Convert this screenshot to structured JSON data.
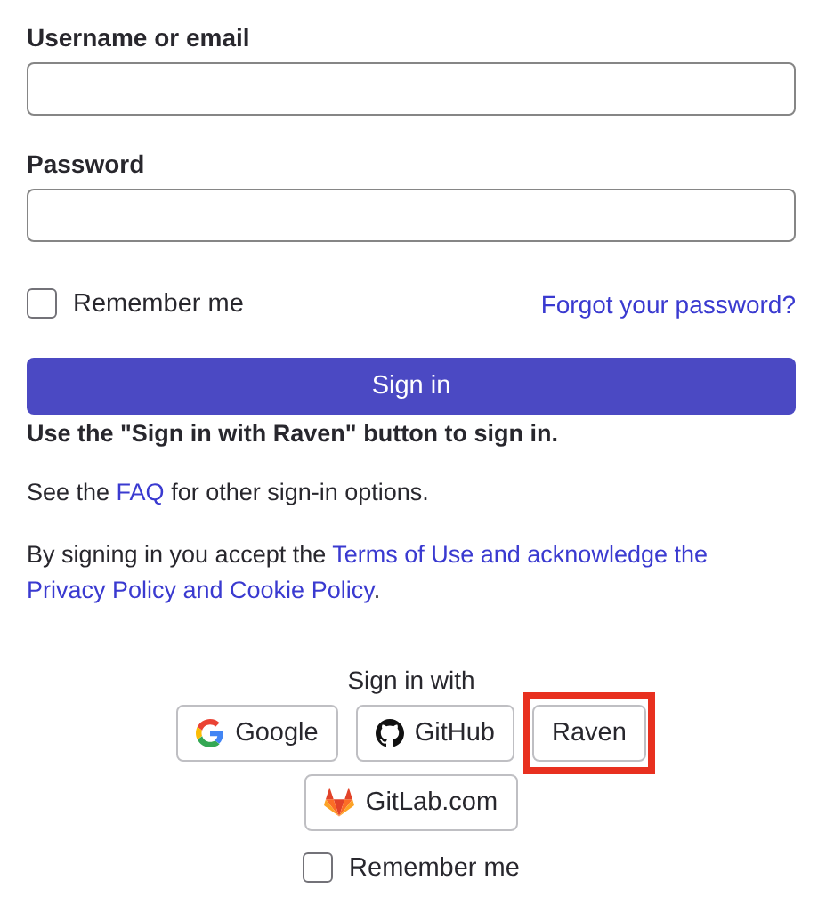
{
  "fields": [
    {
      "label": "Username or email"
    },
    {
      "label": "Password"
    }
  ],
  "remember": {
    "label": "Remember me",
    "checked": false
  },
  "forgot_link": "Forgot your password?",
  "submit": "Sign in",
  "notice": "Use the \"Sign in with Raven\" button to sign in.",
  "faq": {
    "before": "See the",
    "link": "FAQ",
    "after": "for other sign-in options."
  },
  "terms": {
    "before": "By signing in you accept the",
    "links": [
      "Terms of Use and acknowledge the",
      "Privacy Policy and Cookie Policy"
    ],
    "after": "."
  },
  "providers_heading": "Sign in with",
  "providers": [
    {
      "kind": "google",
      "label": "Google",
      "highlighted": false
    },
    {
      "kind": "github",
      "label": "GitHub",
      "highlighted": false
    },
    {
      "kind": "plain",
      "label": "Raven",
      "highlighted": true
    },
    {
      "kind": "gitlab",
      "label": "GitLab.com",
      "highlighted": false
    }
  ],
  "provider_remember": {
    "label": "Remember me",
    "checked": false
  }
}
